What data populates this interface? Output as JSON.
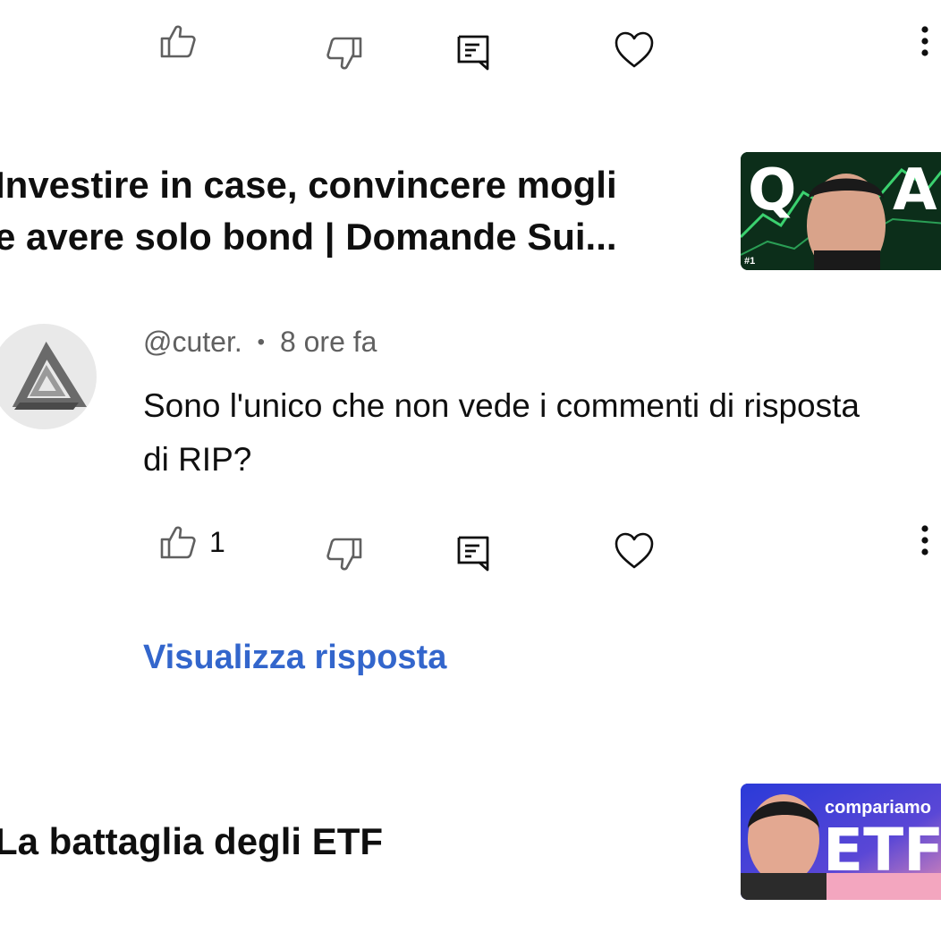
{
  "top_actions": {
    "like_count": ""
  },
  "video1": {
    "title_line1": "Investire in case, convincere mogli",
    "title_line2": "e avere solo bond | Domande Sui...",
    "thumb_letter_left": "Q",
    "thumb_letter_right": "A",
    "thumb_badge": "#1"
  },
  "comment": {
    "author": "@cuter.",
    "separator": "•",
    "time": "8 ore fa",
    "text": "Sono l'unico che non vede i commenti di risposta di RIP?",
    "like_count": "1",
    "reply_label": "Visualizza risposta"
  },
  "video2": {
    "title": "La battaglia degli ETF",
    "thumb_text_small": "compariamo",
    "thumb_text_big": "ETF"
  },
  "colors": {
    "link": "#3366cc",
    "meta": "#606060",
    "text": "#0f0f0f"
  },
  "icons": [
    "thumbs-up-icon",
    "thumbs-down-icon",
    "reply-icon",
    "heart-icon",
    "more-vert-icon",
    "avatar-impossible-triangle"
  ]
}
